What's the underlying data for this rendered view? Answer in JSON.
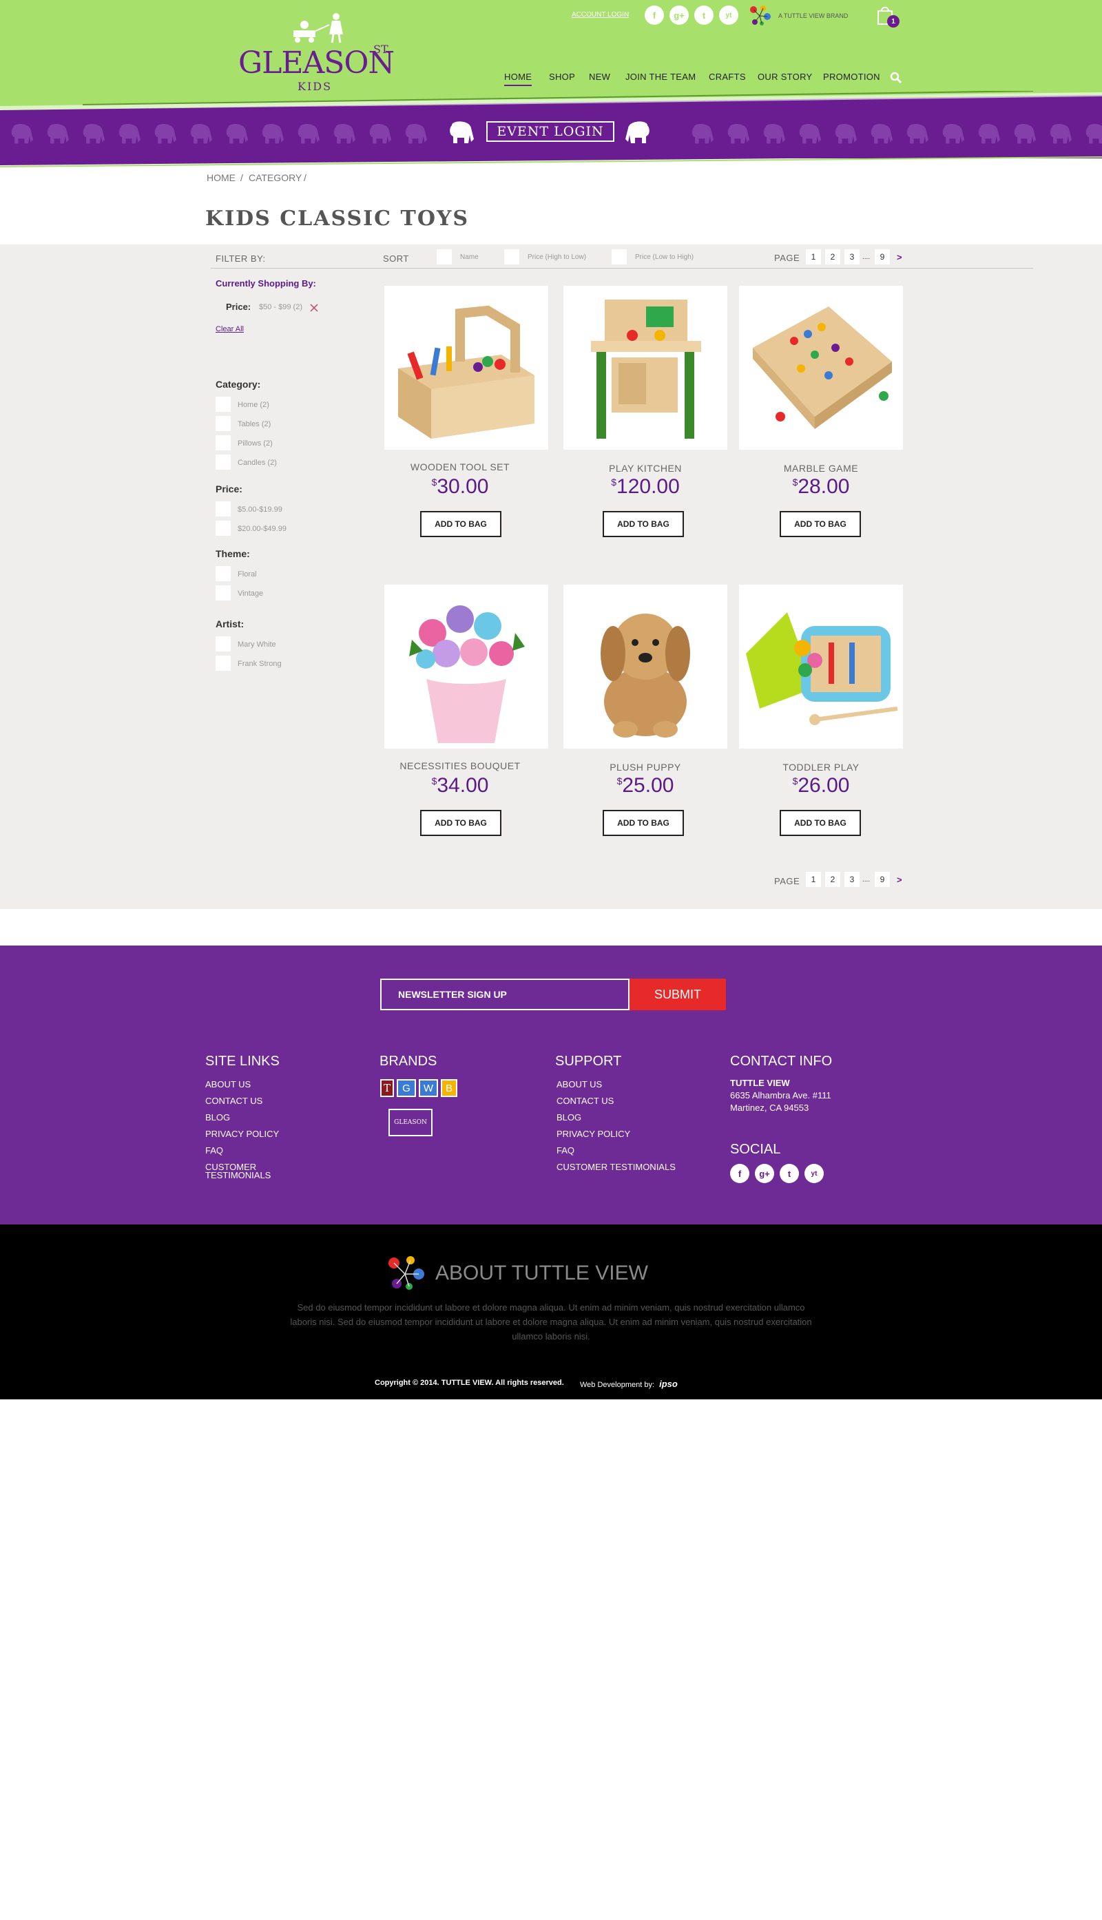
{
  "header": {
    "account_login": "ACCOUNT LOGIN",
    "brand_tag": "A TUTTLE VIEW BRAND",
    "cart_count": "1",
    "logo": {
      "main": "GLEASON",
      "st": "ST.",
      "kids": "KIDS"
    },
    "nav": [
      "HOME",
      "SHOP",
      "NEW",
      "JOIN THE TEAM",
      "CRAFTS",
      "OUR STORY",
      "PROMOTION"
    ],
    "social": [
      "f",
      "g+",
      "t",
      "yt"
    ],
    "event_login": "EVENT LOGIN"
  },
  "breadcrumb": [
    "HOME",
    "/",
    "CATEGORY",
    "/"
  ],
  "page_title": "KIDS CLASSIC TOYS",
  "toolbar": {
    "filter_by": "FILTER BY:",
    "sort": "SORT",
    "sort_options": [
      "Name",
      "Price (High to Low)",
      "Price (Low to High)"
    ],
    "page_label": "PAGE",
    "pages": [
      "1",
      "2",
      "3",
      "....",
      "9"
    ],
    "next": ">"
  },
  "sidebar": {
    "currently_shopping": "Currently Shopping By:",
    "active_filter_label": "Price:",
    "active_filter_value": "$50 - $99 (2)",
    "clear_all": "Clear All",
    "groups": [
      {
        "title": "Category:",
        "options": [
          "Home (2)",
          "Tables (2)",
          "Pillows (2)",
          "Candles (2)"
        ]
      },
      {
        "title": "Price:",
        "options": [
          "$5.00-$19.99",
          "$20.00-$49.99"
        ]
      },
      {
        "title": "Theme:",
        "options": [
          "Floral",
          "Vintage"
        ]
      },
      {
        "title": "Artist:",
        "options": [
          "Mary White",
          "Frank Strong"
        ]
      }
    ]
  },
  "products": [
    {
      "name": "WOODEN TOOL SET",
      "currency": "$",
      "price": "30.00",
      "cta": "ADD TO BAG"
    },
    {
      "name": "PLAY KITCHEN",
      "currency": "$",
      "price": "120.00",
      "cta": "ADD TO BAG"
    },
    {
      "name": "MARBLE GAME",
      "currency": "$",
      "price": "28.00",
      "cta": "ADD TO BAG"
    },
    {
      "name": "NECESSITIES BOUQUET",
      "currency": "$",
      "price": "34.00",
      "cta": "ADD TO BAG"
    },
    {
      "name": "PLUSH PUPPY",
      "currency": "$",
      "price": "25.00",
      "cta": "ADD TO BAG"
    },
    {
      "name": "TODDLER PLAY",
      "currency": "$",
      "price": "26.00",
      "cta": "ADD TO BAG"
    }
  ],
  "footer": {
    "newsletter_placeholder": "NEWSLETTER SIGN UP",
    "submit": "SUBMIT",
    "site_links_title": "SITE LINKS",
    "site_links": [
      "ABOUT US",
      "CONTACT US",
      "BLOG",
      "PRIVACY POLICY",
      "FAQ",
      "CUSTOMER",
      "TESTIMONIALS"
    ],
    "brands_title": "BRANDS",
    "brand_letters": [
      "T",
      "G",
      "W",
      "B"
    ],
    "brand_logo_text": "GLEASON",
    "support_title": "SUPPORT",
    "support_links": [
      "ABOUT US",
      "CONTACT US",
      "BLOG",
      "PRIVACY POLICY",
      "FAQ",
      "CUSTOMER TESTIMONIALS"
    ],
    "contact_title": "CONTACT INFO",
    "contact_name": "TUTTLE VIEW",
    "contact_addr1": "6635 Alhambra Ave. #111",
    "contact_addr2": "Martinez, CA 94553",
    "social_title": "SOCIAL"
  },
  "about": {
    "title": "ABOUT TUTTLE VIEW",
    "body": "Sed do eiusmod tempor incididunt ut labore et dolore magna aliqua. Ut enim ad minim veniam, quis nostrud exercitation ullamco laboris nisi. Sed do eiusmod tempor incididunt ut labore et dolore magna aliqua. Ut enim ad minim veniam, quis nostrud exercitation ullamco laboris nisi.",
    "copyright": "Copyright © 2014. TUTTLE VIEW. All rights reserved.",
    "webdev_label": "Web Development by:",
    "webdev_brand": "ipso"
  },
  "colors": {
    "green": "#a7e16c",
    "purple": "#6a1c91",
    "footer_purple": "#6e2a95",
    "red": "#e62a2a",
    "gray_bg": "#efeeed"
  }
}
